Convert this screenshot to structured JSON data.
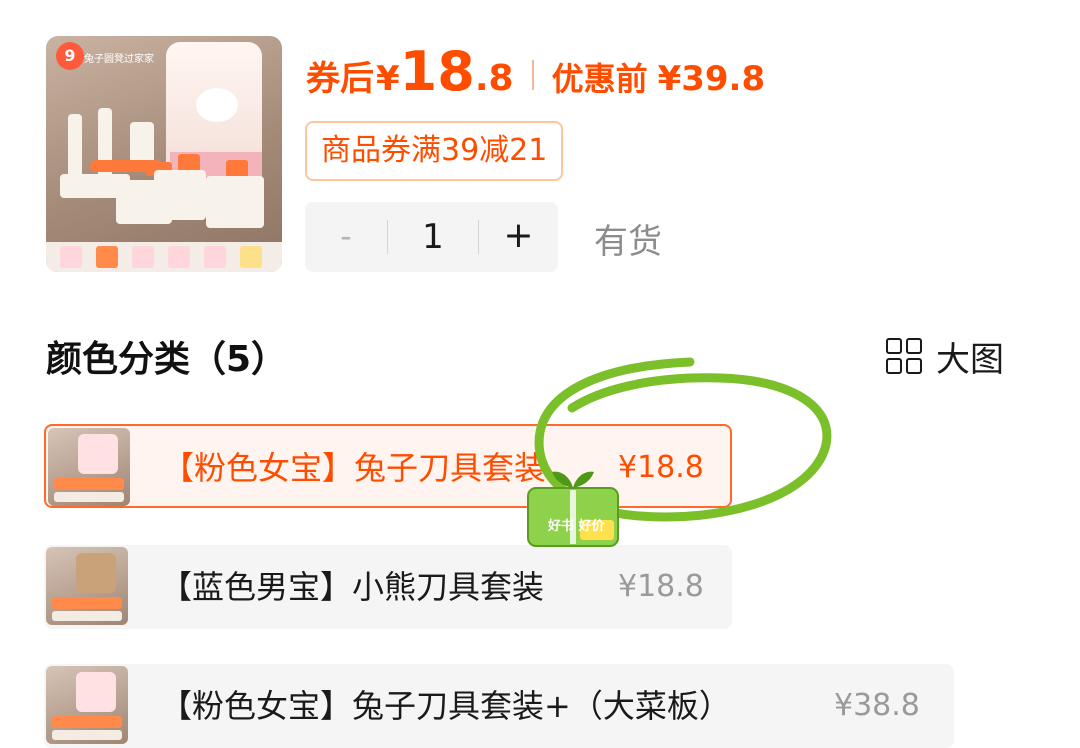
{
  "product": {
    "thumbnail_badge": "9",
    "thumbnail_caption": "兔子圆凳过家家"
  },
  "price": {
    "after_coupon_label": "券后",
    "currency": "¥",
    "after_coupon_int": "18",
    "after_coupon_dec": ".8",
    "before_label": "优惠前",
    "before_value": "¥39.8"
  },
  "coupon_tag": "商品券满39减21",
  "quantity": {
    "minus": "-",
    "value": "1",
    "plus": "+"
  },
  "stock_status": "有货",
  "section": {
    "title": "颜色分类（5）",
    "large_view_label": "大图",
    "large_view_icon": "grid-icon"
  },
  "variants": [
    {
      "name": "【粉色女宝】兔子刀具套装",
      "price": "¥18.8",
      "selected": true
    },
    {
      "name": "【蓝色男宝】小熊刀具套装",
      "price": "¥18.8",
      "selected": false
    },
    {
      "name": "【粉色女宝】兔子刀具套装+（大菜板）",
      "price": "¥38.8",
      "selected": false
    }
  ],
  "overlay": {
    "book_badge_text": "好书 好价",
    "annotation_color": "#7bbf2a"
  },
  "colors": {
    "accent": "#ff4d00",
    "selected_border": "#ff6a2b",
    "muted": "#8c8c8c"
  }
}
